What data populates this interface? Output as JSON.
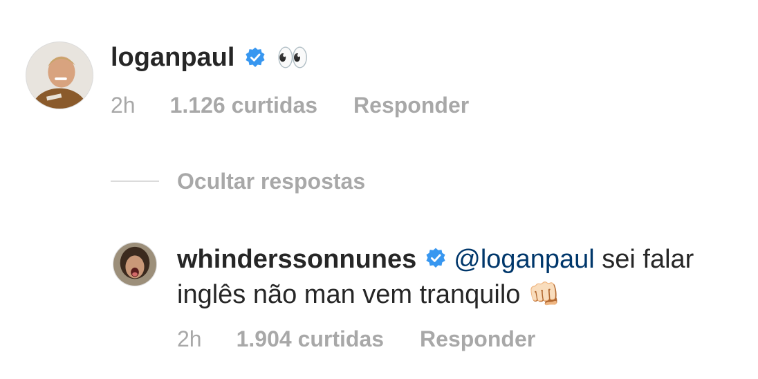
{
  "comment": {
    "username": "loganpaul",
    "verified_icon": "verified-badge-icon",
    "text": "👀",
    "time": "2h",
    "likes": "1.126 curtidas",
    "reply_label": "Responder"
  },
  "replies_toggle": {
    "label": "Ocultar respostas"
  },
  "reply": {
    "username": "whinderssonnunes",
    "verified_icon": "verified-badge-icon",
    "mention": "@loganpaul",
    "text": "sei falar inglês não man vem tranquilo",
    "emoji": "👊🏻",
    "time": "2h",
    "likes": "1.904 curtidas",
    "reply_label": "Responder"
  },
  "colors": {
    "text": "#262626",
    "secondary": "#a8a8a8",
    "mention": "#00376b",
    "verified": "#3897f0"
  }
}
